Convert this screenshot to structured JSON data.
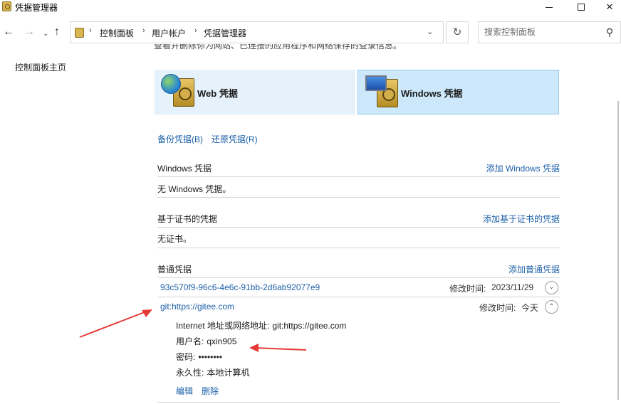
{
  "window": {
    "title": "凭据管理器",
    "minimize": "—",
    "close": "✕"
  },
  "nav": {
    "back": "←",
    "forward": "→",
    "recent": "⌄",
    "up": "↑",
    "breadcrumb": [
      "控制面板",
      "用户帐户",
      "凭据管理器"
    ],
    "separator": "›",
    "refresh": "↻",
    "search_placeholder": "搜索控制面板"
  },
  "sidebar": {
    "home": "控制面板主页"
  },
  "main": {
    "intro_clipped": "查看并删除你为网站、已连接的应用程序和网络保存的登录信息。",
    "tiles": {
      "web": "Web 凭据",
      "windows": "Windows 凭据"
    },
    "backup": "备份凭据(B)",
    "restore": "还原凭据(R)",
    "windows_section": {
      "title": "Windows 凭据",
      "add": "添加 Windows 凭据",
      "empty": "无 Windows 凭据。"
    },
    "cert_section": {
      "title": "基于证书的凭据",
      "add": "添加基于证书的凭据",
      "empty": "无证书。"
    },
    "generic_section": {
      "title": "普通凭据",
      "add": "添加普通凭据",
      "items": [
        {
          "name": "93c570f9-96c6-4e6c-91bb-2d6ab92077e9",
          "modified_label": "修改时间:",
          "modified": "2023/11/29",
          "expanded": false
        },
        {
          "name": "git:https://gitee.com",
          "modified_label": "修改时间:",
          "modified": "今天",
          "expanded": true
        }
      ],
      "detail": {
        "address_label": "Internet 地址或网络地址:",
        "address": "git:https://gitee.com",
        "user_label": "用户名:",
        "user": "qxin905",
        "password_label": "密码:",
        "password": "••••••••",
        "persistence_label": "永久性:",
        "persistence": "本地计算机",
        "edit": "编辑",
        "delete": "删除"
      }
    }
  },
  "annotations": {
    "arrow_color": "#e53935"
  }
}
